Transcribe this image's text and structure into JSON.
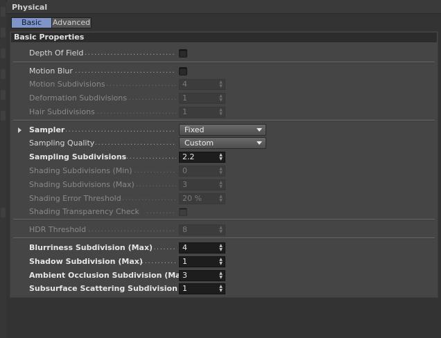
{
  "panel": {
    "title": "Physical"
  },
  "tabs": [
    {
      "label": "Basic",
      "active": true
    },
    {
      "label": "Advanced",
      "active": false
    }
  ],
  "group": {
    "title": "Basic Properties"
  },
  "fields": {
    "depth_of_field": {
      "label": "Depth Of Field",
      "checked": false
    },
    "motion_blur": {
      "label": "Motion Blur",
      "checked": false
    },
    "motion_subdivisions": {
      "label": "Motion Subdivisions",
      "value": "4"
    },
    "deformation_subdivisions": {
      "label": "Deformation Subdivisions",
      "value": "1"
    },
    "hair_subdivisions": {
      "label": "Hair Subdivisions",
      "value": "1"
    },
    "sampler": {
      "label": "Sampler",
      "value": "Fixed"
    },
    "sampling_quality": {
      "label": "Sampling Quality",
      "value": "Custom"
    },
    "sampling_subdivisions": {
      "label": "Sampling Subdivisions",
      "value": "2.2"
    },
    "shading_subdivisions_min": {
      "label": "Shading Subdivisions (Min)",
      "value": "0"
    },
    "shading_subdivisions_max": {
      "label": "Shading Subdivisions (Max)",
      "value": "3"
    },
    "shading_error_threshold": {
      "label": "Shading Error Threshold",
      "value": "20 %"
    },
    "shading_transparency_check": {
      "label": "Shading Transparency Check",
      "checked": false
    },
    "hdr_threshold": {
      "label": "HDR Threshold",
      "value": "8"
    },
    "blurriness_subdivision": {
      "label": "Blurriness Subdivision (Max)",
      "value": "4"
    },
    "shadow_subdivision": {
      "label": "Shadow Subdivision (Max)",
      "value": "1"
    },
    "ao_subdivision": {
      "label": "Ambient Occlusion Subdivision (Max)",
      "value": "3"
    },
    "sss_subdivision": {
      "label": "Subsurface Scattering Subdivision (Max)",
      "value": "1"
    }
  },
  "colors": {
    "active_tab": "#7f95c7",
    "panel_bg": "#454545",
    "field_bg": "#1d1d1d"
  }
}
